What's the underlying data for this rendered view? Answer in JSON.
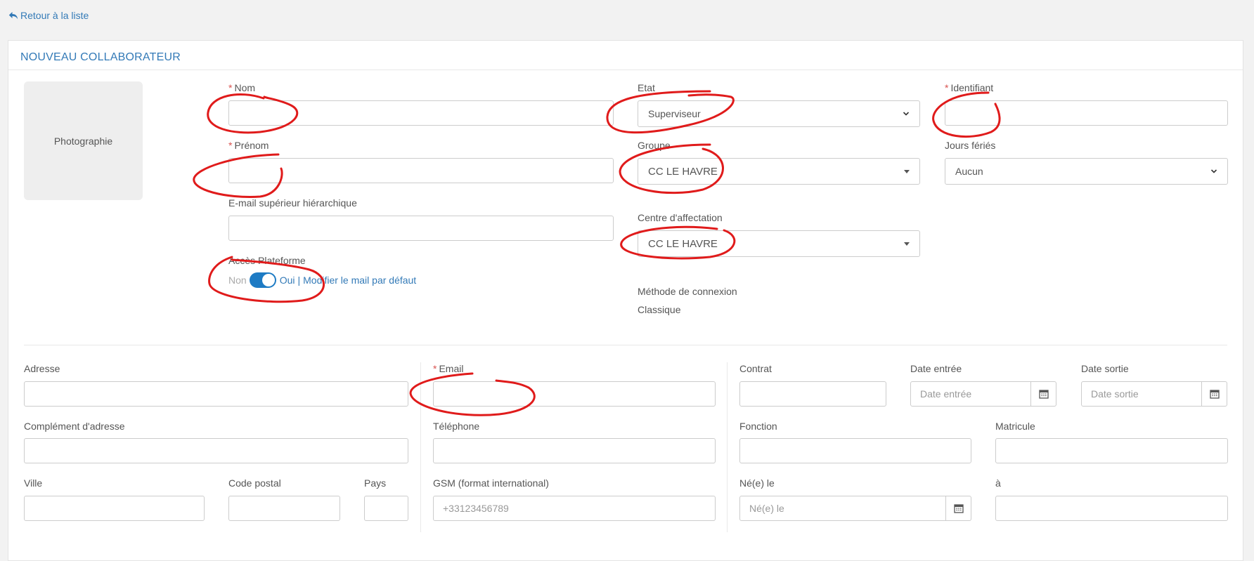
{
  "nav": {
    "back_label": "Retour à la liste"
  },
  "panel": {
    "title": "NOUVEAU COLLABORATEUR"
  },
  "photo": {
    "label": "Photographie"
  },
  "identity": {
    "nom_label": "Nom",
    "prenom_label": "Prénom",
    "email_sup_label": "E-mail supérieur hiérarchique",
    "acces_label": "Accès Plateforme",
    "toggle_off": "Non",
    "toggle_on": "Oui",
    "toggle_sep": "|",
    "modify_mail_link": "Modifier le mail par défaut",
    "required_mark": "*"
  },
  "status": {
    "etat_label": "Etat",
    "etat_value": "Superviseur",
    "groupe_label": "Groupe",
    "groupe_value": "CC LE HAVRE",
    "centre_label": "Centre d'affectation",
    "centre_value": "CC LE HAVRE",
    "methode_label": "Méthode de connexion",
    "methode_value": "Classique"
  },
  "account": {
    "identifiant_label": "Identifiant",
    "jours_label": "Jours fériés",
    "jours_value": "Aucun"
  },
  "address": {
    "adresse_label": "Adresse",
    "complement_label": "Complément d'adresse",
    "ville_label": "Ville",
    "cp_label": "Code postal",
    "pays_label": "Pays"
  },
  "contact": {
    "email_label": "Email",
    "tel_label": "Téléphone",
    "gsm_label": "GSM (format international)",
    "gsm_placeholder": "+33123456789"
  },
  "contract": {
    "contrat_label": "Contrat",
    "date_entree_label": "Date entrée",
    "date_entree_placeholder": "Date entrée",
    "date_sortie_label": "Date sortie",
    "date_sortie_placeholder": "Date sortie",
    "fonction_label": "Fonction",
    "matricule_label": "Matricule",
    "ne_le_label": "Né(e) le",
    "ne_le_placeholder": "Né(e) le",
    "a_label": "à"
  },
  "colors": {
    "accent": "#337ab7",
    "required": "#d9534f",
    "annotation": "#e01b1b",
    "toggle": "#1e7bc4"
  }
}
